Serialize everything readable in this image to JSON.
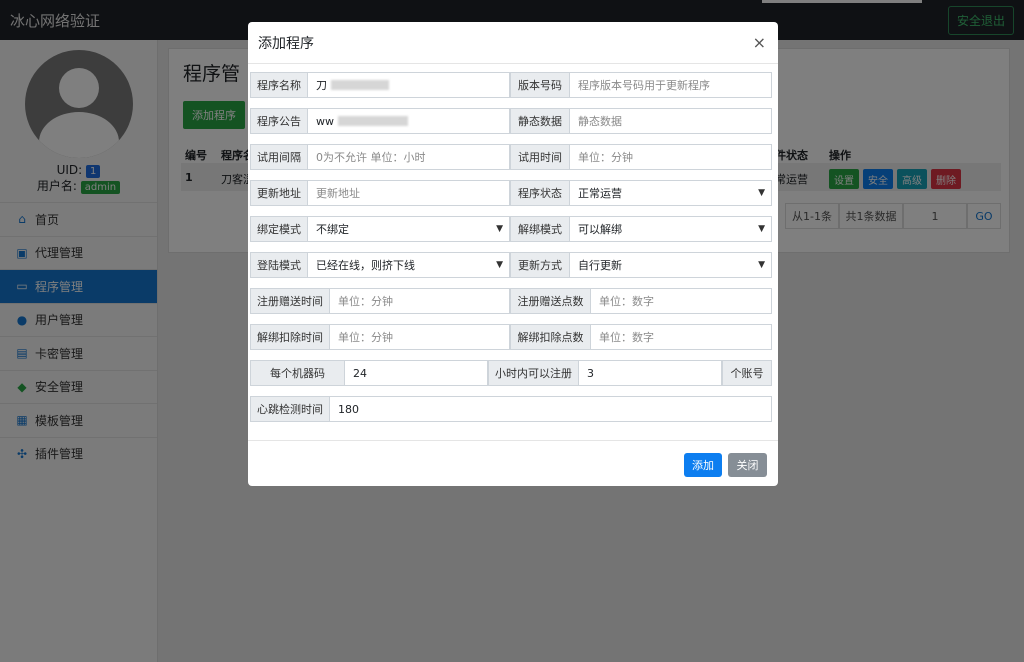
{
  "navbar": {
    "brand": "冰心网络验证",
    "logout_label": "安全退出"
  },
  "sidebar": {
    "uid_label": "UID:",
    "uid_value": "1",
    "username_label": "用户名:",
    "username_value": "admin",
    "items": [
      {
        "label": "首页",
        "icon": "home-icon"
      },
      {
        "label": "代理管理",
        "icon": "agent-icon"
      },
      {
        "label": "程序管理",
        "icon": "program-icon"
      },
      {
        "label": "用户管理",
        "icon": "user-icon"
      },
      {
        "label": "卡密管理",
        "icon": "card-icon"
      },
      {
        "label": "安全管理",
        "icon": "shield-icon"
      },
      {
        "label": "模板管理",
        "icon": "template-icon"
      },
      {
        "label": "插件管理",
        "icon": "plugin-icon"
      }
    ]
  },
  "main": {
    "title": "程序管",
    "add_button": "添加程序",
    "table": {
      "headers": [
        "编号",
        "程序名",
        "件状态",
        "操作"
      ],
      "row": {
        "id": "1",
        "name": "刀客涩",
        "status": "常运营"
      },
      "actions": [
        "设置",
        "安全",
        "高级",
        "删除"
      ]
    },
    "pager": {
      "range": "从1-1条",
      "total": "共1条数据",
      "page": "1",
      "go": "GO"
    }
  },
  "modal": {
    "title": "添加程序",
    "close": "×",
    "fields": {
      "name": {
        "label": "程序名称",
        "value": "刀"
      },
      "version": {
        "label": "版本号码",
        "placeholder": "程序版本号码用于更新程序"
      },
      "notice": {
        "label": "程序公告",
        "value": "ww"
      },
      "static": {
        "label": "静态数据",
        "placeholder": "静态数据"
      },
      "trial_interval": {
        "label": "试用间隔",
        "placeholder": "0为不允许 单位：小时"
      },
      "trial_time": {
        "label": "试用时间",
        "placeholder": "单位：分钟"
      },
      "update_url": {
        "label": "更新地址",
        "placeholder": "更新地址"
      },
      "status": {
        "label": "程序状态",
        "value": "正常运营"
      },
      "bind_mode": {
        "label": "绑定模式",
        "value": "不绑定"
      },
      "unbind_mode": {
        "label": "解绑模式",
        "value": "可以解绑"
      },
      "login_mode": {
        "label": "登陆模式",
        "value": "已经在线，则挤下线"
      },
      "update_mode": {
        "label": "更新方式",
        "value": "自行更新"
      },
      "reg_gift_time": {
        "label": "注册赠送时间",
        "placeholder": "单位：分钟"
      },
      "reg_gift_points": {
        "label": "注册赠送点数",
        "placeholder": "单位：数字"
      },
      "unbind_deduct_time": {
        "label": "解绑扣除时间",
        "placeholder": "单位：分钟"
      },
      "unbind_deduct_points": {
        "label": "解绑扣除点数",
        "placeholder": "单位：数字"
      },
      "per_machine": {
        "label": "每个机器码",
        "value": "24"
      },
      "hours_register": {
        "label": "小时内可以注册",
        "value": "3"
      },
      "accounts_suffix": {
        "label": "个账号"
      },
      "heartbeat": {
        "label": "心跳检测时间",
        "value": "180"
      }
    },
    "add_button": "添加",
    "close_button": "关闭"
  }
}
